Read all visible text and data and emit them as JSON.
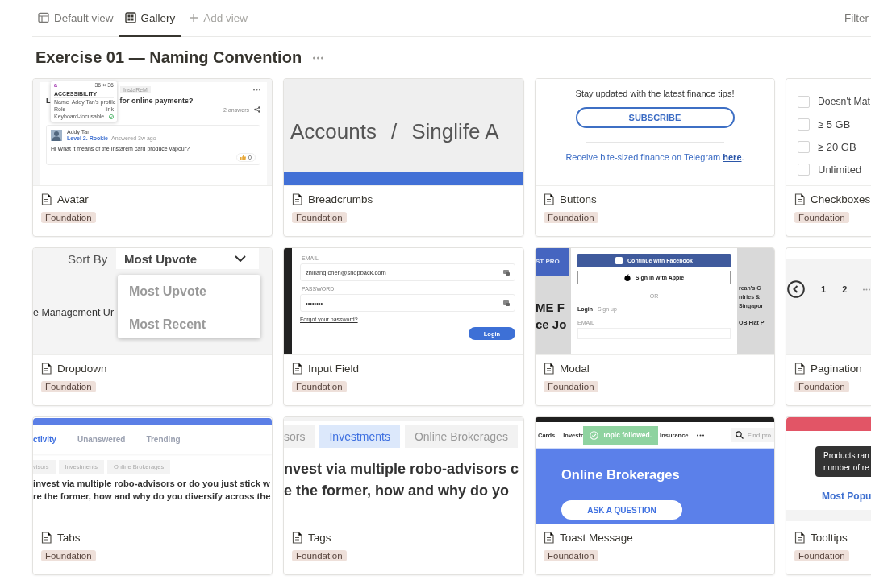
{
  "view_tabs": [
    {
      "label": "Default view",
      "selected": false
    },
    {
      "label": "Gallery",
      "selected": true
    }
  ],
  "add_view": "Add view",
  "filter": "Filter",
  "title": "Exercise 01 — Naming Convention",
  "cards": [
    {
      "title": "Avatar",
      "tag": "Foundation",
      "preview": {
        "kind": "qa-post",
        "chip": "InstaReM",
        "question_start": "L",
        "question_end": "for online payments?",
        "answers": "2 answers",
        "author": "Addy Tan",
        "level": "Level 2. Rookie",
        "answered": "Answered 3w ago",
        "answer": "Hi What it means of the Instarem card produce vapour?",
        "likes": "0",
        "inspector": {
          "element": "a",
          "size": "36 × 36",
          "heading": "ACCESSIBILITY",
          "rows": [
            {
              "label": "Name",
              "value": "Addy Tan's profile"
            },
            {
              "label": "Role",
              "value": "link"
            },
            {
              "label": "Keyboard-focusable",
              "kind": "check"
            }
          ]
        }
      }
    },
    {
      "title": "Breadcrumbs",
      "tag": "Foundation",
      "preview": {
        "kind": "breadcrumbs",
        "items": [
          "Accounts",
          "Singlife A"
        ],
        "separator": "/"
      }
    },
    {
      "title": "Buttons",
      "tag": "Foundation",
      "preview": {
        "kind": "newsletter",
        "text": "Stay updated with the latest finance tips!",
        "button": "SUBSCRIBE",
        "note": "Receive bite-sized finance on Telegram",
        "link": "here",
        "note_end": "."
      }
    },
    {
      "title": "Checkboxes",
      "tag": "Foundation",
      "preview": {
        "kind": "checklist",
        "options": [
          {
            "label": "Doesn't Mat",
            "checked": false
          },
          {
            "label": "≥ 5 GB",
            "checked": false
          },
          {
            "label": "≥ 20 GB",
            "checked": false
          },
          {
            "label": "Unlimited",
            "checked": false
          }
        ]
      }
    },
    {
      "title": "Dropdown",
      "tag": "Foundation",
      "preview": {
        "kind": "dropdown",
        "label": "Sort By",
        "value": "Most Upvote",
        "options": [
          "Most Upvote",
          "Most Recent"
        ],
        "background_text": "e Management Ur"
      }
    },
    {
      "title": "Input Field",
      "tag": "Foundation",
      "preview": {
        "kind": "login-form",
        "fields": [
          {
            "label": "EMAIL",
            "value": "zhiliang.chen@shopback.com"
          },
          {
            "label": "PASSWORD",
            "value": "••••••••"
          }
        ],
        "link": "Forgot your password?",
        "button": "Login"
      }
    },
    {
      "title": "Modal",
      "tag": "Foundation",
      "preview": {
        "kind": "modal",
        "background_left": [
          "ST PRO",
          "ME F",
          "ce Jo"
        ],
        "background_right": [
          "rean's G",
          "ntries &",
          "Singapor",
          "OB Flat P"
        ],
        "facebook": "Continue with Facebook",
        "apple": "Sign in with Apple",
        "divider": "OR",
        "tabs": [
          {
            "label": "Login",
            "selected": true
          },
          {
            "label": "Sign up",
            "selected": false
          }
        ],
        "field_label": "EMAIL"
      }
    },
    {
      "title": "Pagination",
      "tag": "Foundation",
      "preview": {
        "kind": "pagination",
        "pages": [
          "1",
          "2"
        ]
      }
    },
    {
      "title": "Tabs",
      "tag": "Foundation",
      "preview": {
        "kind": "tabs",
        "tabs": [
          {
            "label": "ctivity",
            "selected": true
          },
          {
            "label": "Unanswered",
            "selected": false
          },
          {
            "label": "Trending",
            "selected": false
          }
        ],
        "chips": [
          "visors",
          "Investments",
          "Online Brokerages"
        ],
        "lines": [
          "invest via multiple robo-advisors or do you just stick w",
          "re the former, how and why do you diversify across the"
        ]
      }
    },
    {
      "title": "Tags",
      "tag": "Foundation",
      "preview": {
        "kind": "tags",
        "chips": [
          {
            "label": "sors",
            "selected": false
          },
          {
            "label": "Investments",
            "selected": true
          },
          {
            "label": "Online Brokerages",
            "selected": false
          }
        ],
        "lines": [
          "nvest via multiple robo-advisors c",
          "e the former, how and why do yo"
        ]
      }
    },
    {
      "title": "Toast Message",
      "tag": "Foundation",
      "preview": {
        "kind": "toast",
        "nav": [
          "Cards",
          "Investr"
        ],
        "toast": "Topic followed.",
        "nav_after": [
          "Insurance"
        ],
        "search": "Find pro",
        "heading": "Online Brokerages",
        "button": "ASK A QUESTION"
      }
    },
    {
      "title": "Tooltips",
      "tag": "Foundation",
      "preview": {
        "kind": "tooltip",
        "tooltip": "Products ran\nnumber of re",
        "tab": "Most Popu"
      }
    }
  ]
}
